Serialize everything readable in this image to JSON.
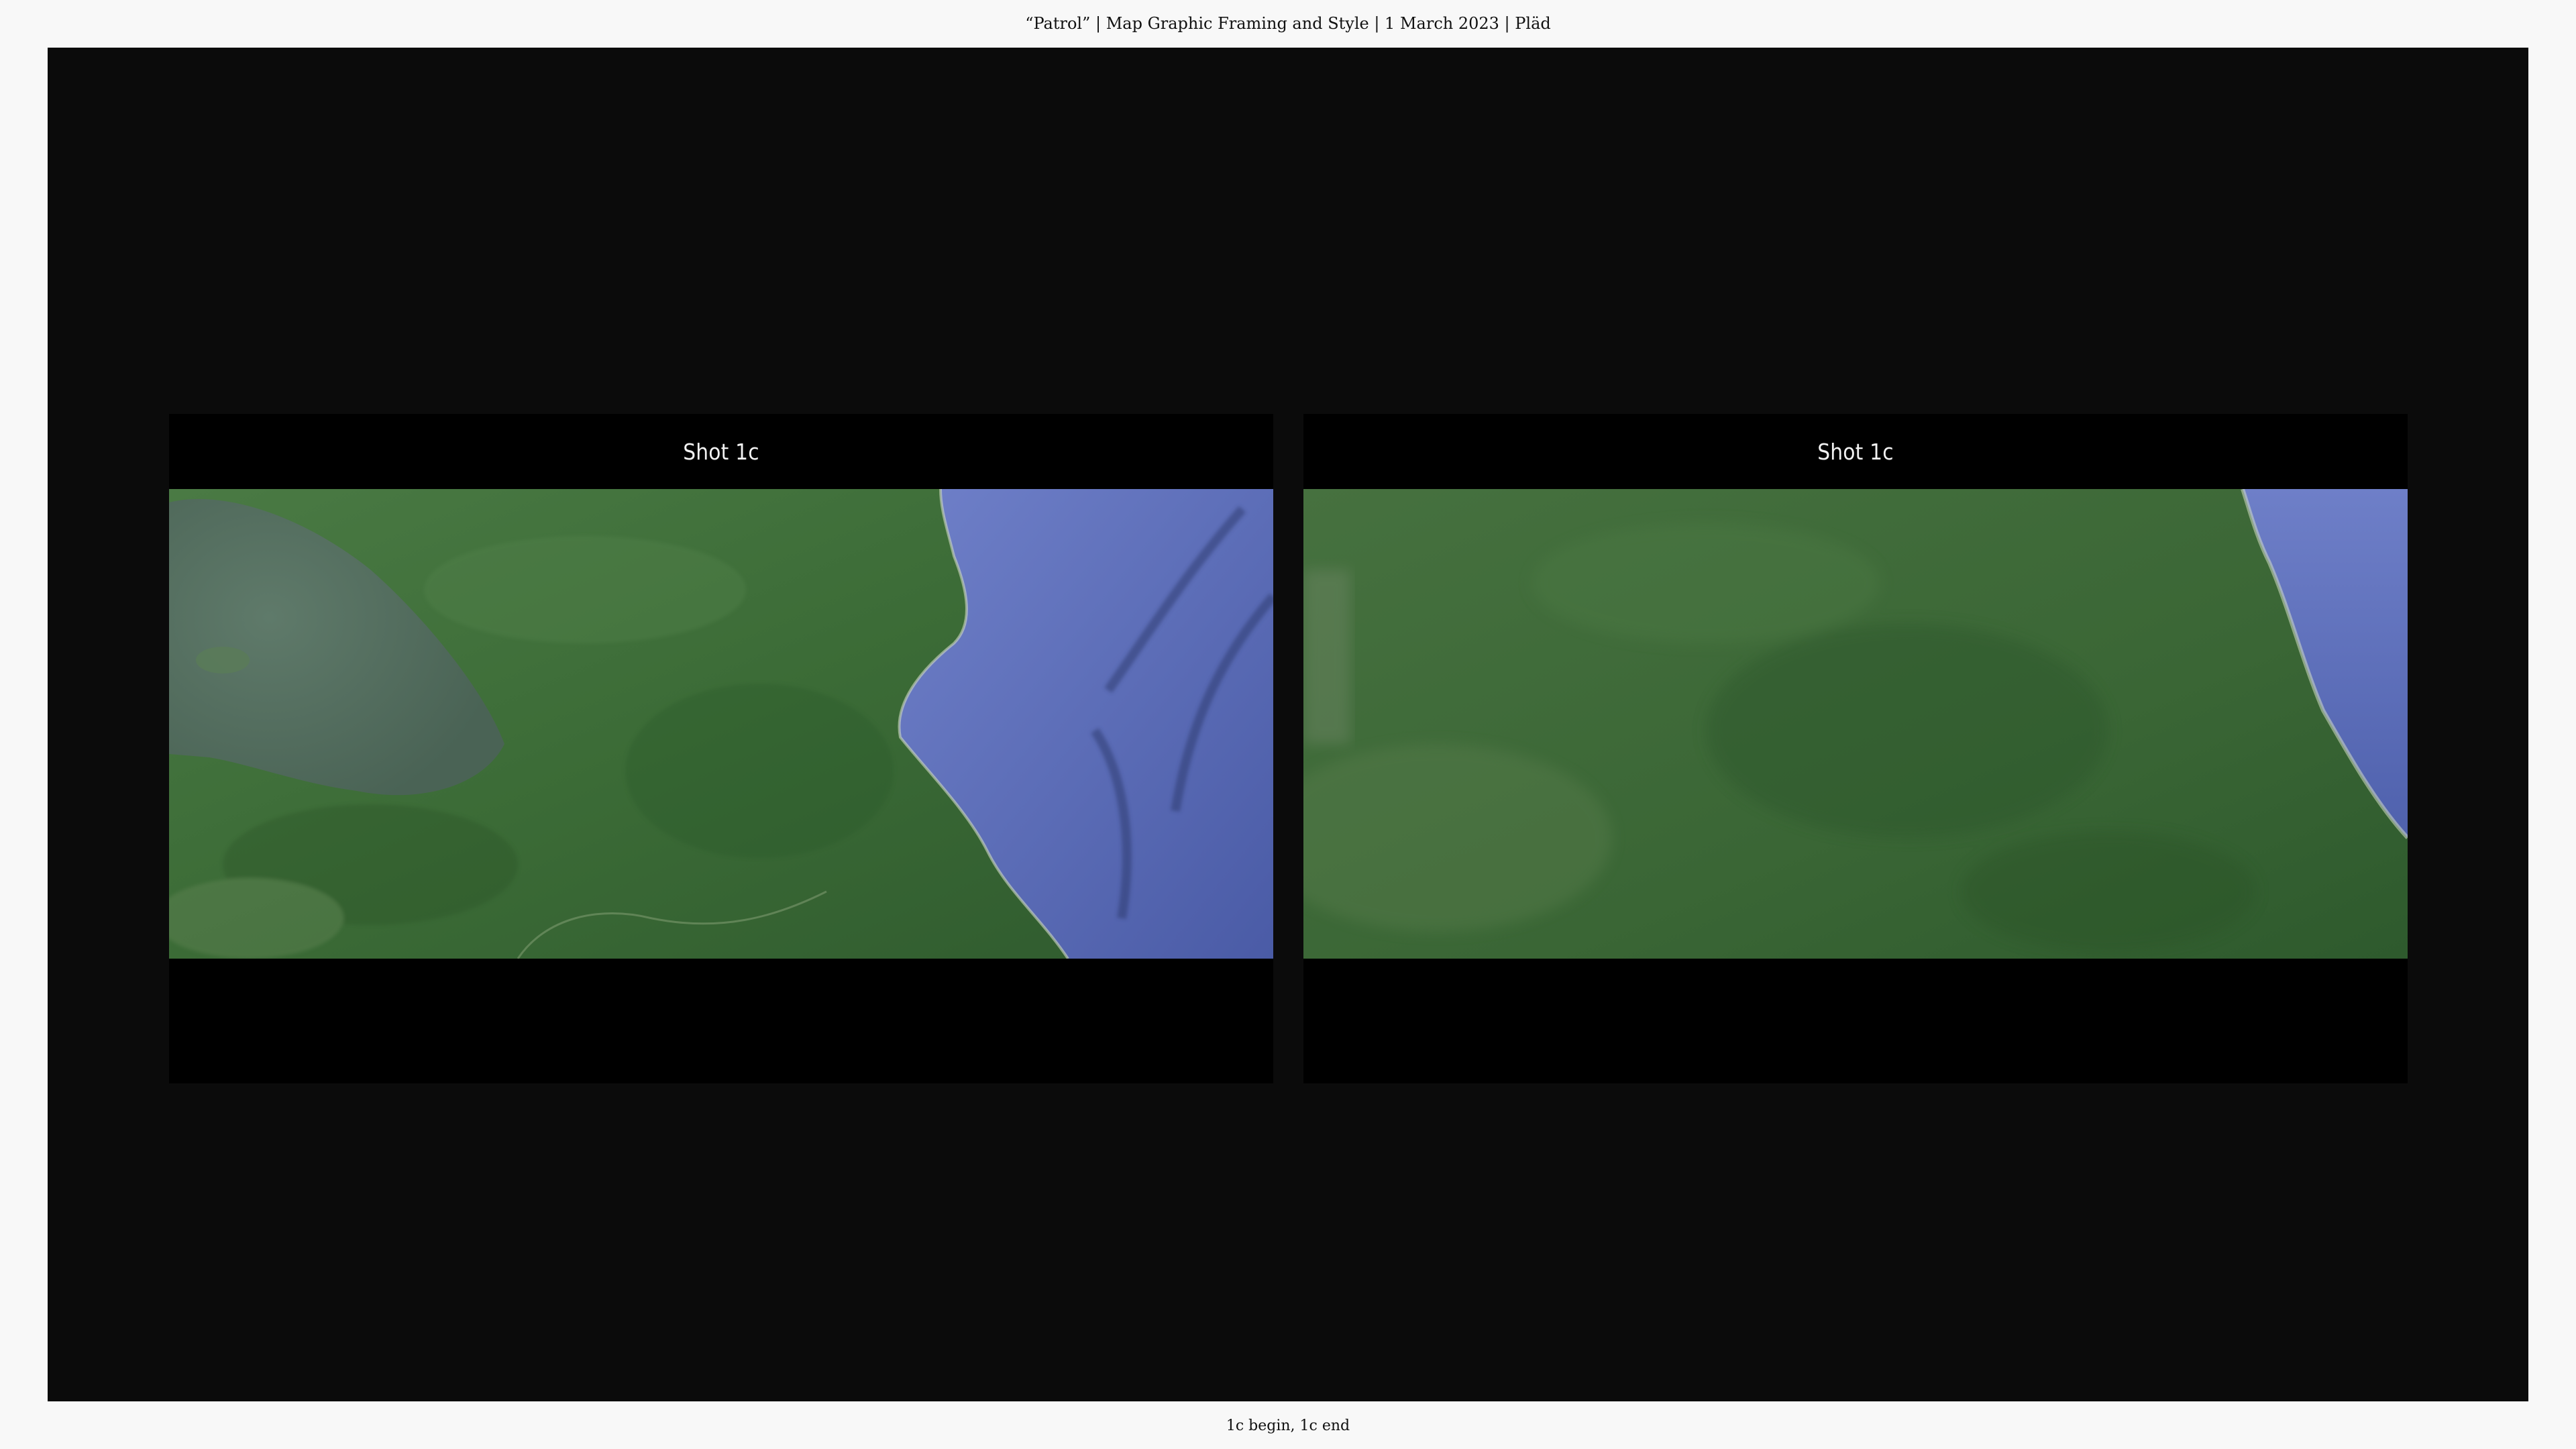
{
  "header": {
    "title": "“Patrol” | Map Graphic Framing and Style | 1 March 2023 | Pläd"
  },
  "panels": [
    {
      "title": "Shot 1c",
      "image_icon": "satellite-map-image"
    },
    {
      "title": "Shot 1c",
      "image_icon": "satellite-map-image"
    }
  ],
  "footer": {
    "caption": "1c begin, 1c end"
  },
  "colors": {
    "page_bg": "#f8f8f8",
    "stage_bg": "#0b0b0b",
    "panel_bg": "#000000",
    "land": "#3a6a37",
    "ocean": "#5d6fbd",
    "lake": "#50695a"
  }
}
